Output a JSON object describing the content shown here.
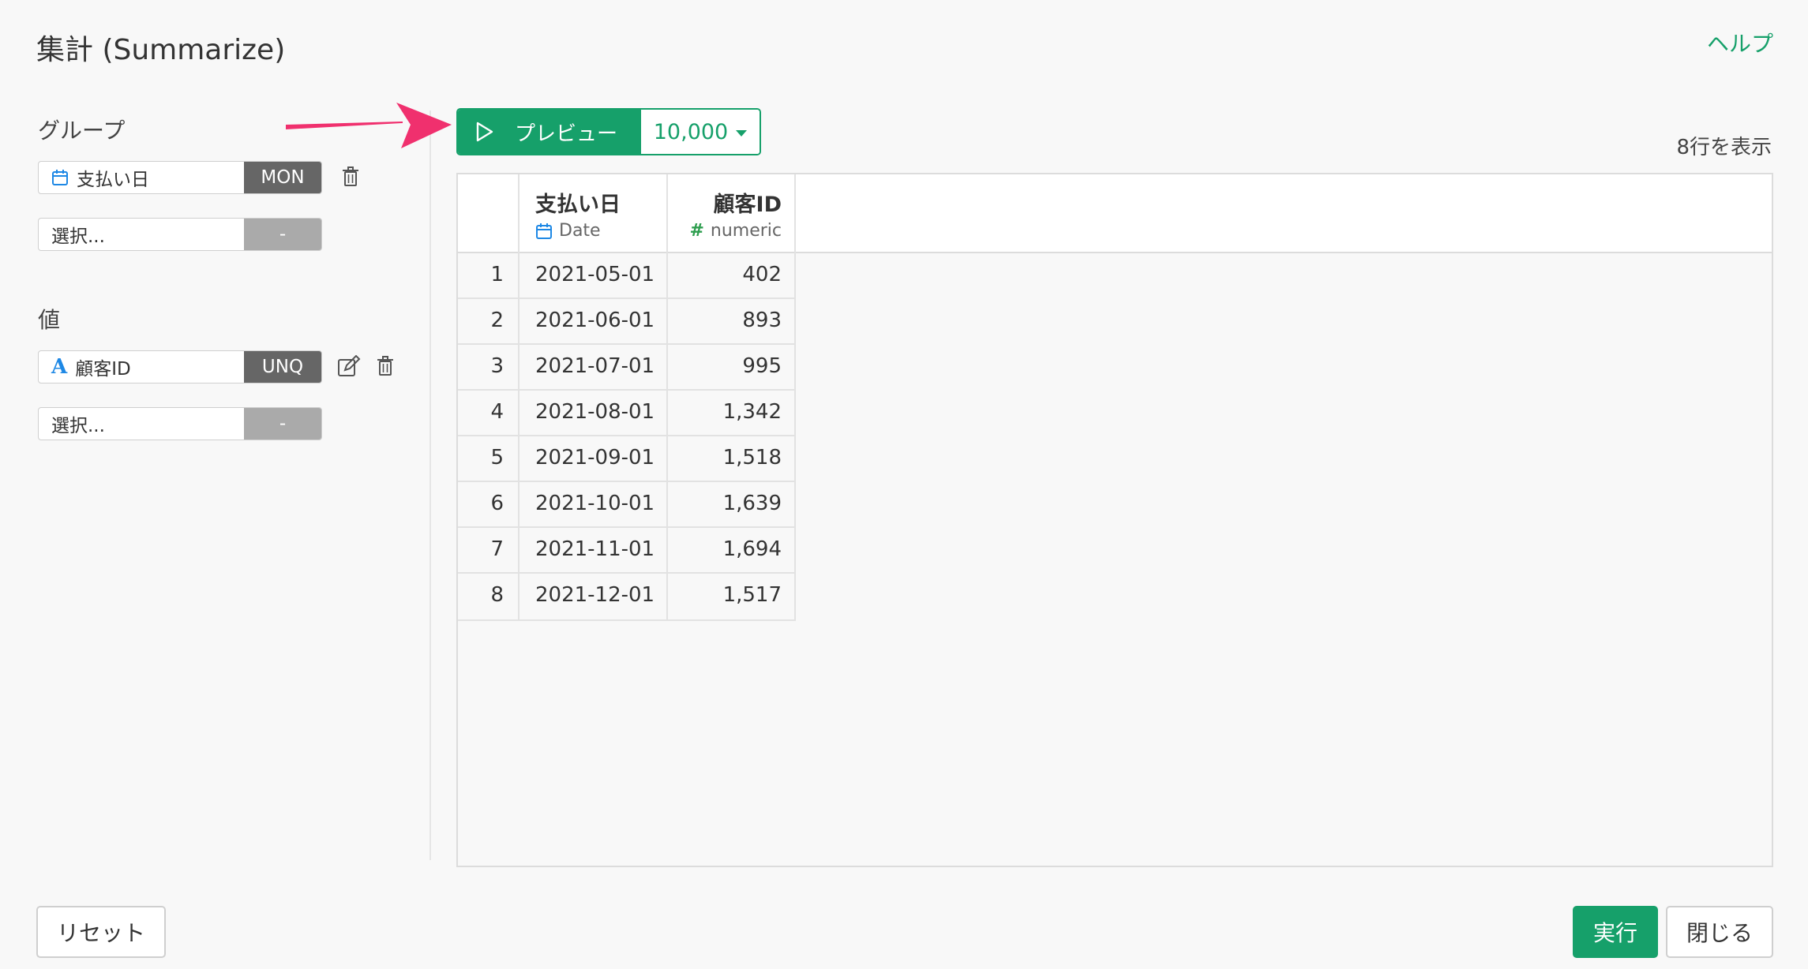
{
  "header": {
    "title": "集計 (Summarize)",
    "help_label": "ヘルプ"
  },
  "sidebar": {
    "group_label": "グループ",
    "group_fields": [
      {
        "name": "支払い日",
        "type_icon": "calendar-icon",
        "aggregation": "MON"
      },
      {
        "name": "選択...",
        "aggregation": "-"
      }
    ],
    "value_label": "値",
    "value_fields": [
      {
        "name": "顧客ID",
        "type_icon": "character-type-icon",
        "aggregation": "UNQ"
      },
      {
        "name": "選択...",
        "aggregation": "-"
      }
    ]
  },
  "preview": {
    "button_label": "プレビュー",
    "rows_option": "10,000",
    "row_count_text": "8行を表示"
  },
  "table": {
    "columns": [
      {
        "name": "支払い日",
        "type": "Date",
        "type_icon": "calendar-icon"
      },
      {
        "name": "顧客ID",
        "type": "numeric",
        "type_icon": "hash-icon"
      }
    ],
    "rows": [
      {
        "index": "1",
        "date": "2021-05-01",
        "value": "402"
      },
      {
        "index": "2",
        "date": "2021-06-01",
        "value": "893"
      },
      {
        "index": "3",
        "date": "2021-07-01",
        "value": "995"
      },
      {
        "index": "4",
        "date": "2021-08-01",
        "value": "1,342"
      },
      {
        "index": "5",
        "date": "2021-09-01",
        "value": "1,518"
      },
      {
        "index": "6",
        "date": "2021-10-01",
        "value": "1,639"
      },
      {
        "index": "7",
        "date": "2021-11-01",
        "value": "1,694"
      },
      {
        "index": "8",
        "date": "2021-12-01",
        "value": "1,517"
      }
    ]
  },
  "footer": {
    "reset_label": "リセット",
    "run_label": "実行",
    "close_label": "閉じる"
  },
  "colors": {
    "accent": "#16a06a",
    "arrow": "#f0306e",
    "calendar_icon": "#1e88e5",
    "hash_icon": "#2e9e4f"
  }
}
